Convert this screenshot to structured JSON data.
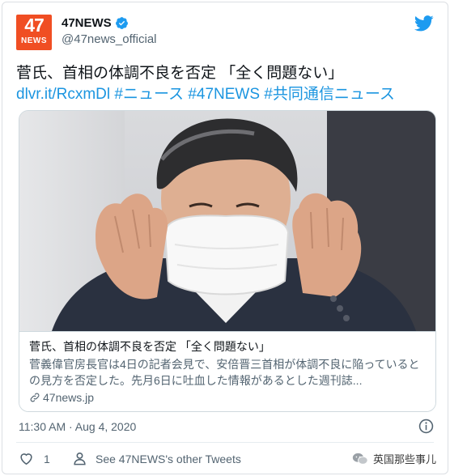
{
  "account": {
    "logo_number": "47",
    "logo_text": "NEWS",
    "display_name": "47NEWS",
    "handle": "@47news_official",
    "verified": true
  },
  "tweet": {
    "text_line1": "菅氏、首相の体調不良を否定 「全く問題ない」",
    "link": "dlvr.it/RcxmDl",
    "hashtag1": "#ニュース",
    "hashtag2": "#47NEWS",
    "hashtag3": "#共同通信ニュース"
  },
  "card": {
    "title": "菅氏、首相の体調不良を否定 「全く問題ない」",
    "description": "菅義偉官房長官は4日の記者会見で、安倍晋三首相が体調不良に陥っているとの見方を否定した。先月6日に吐血した情報があるとした週刊誌...",
    "domain": "47news.jp"
  },
  "meta": {
    "timestamp": "11:30 AM · Aug 4, 2020"
  },
  "actions": {
    "like_count": "1",
    "other_tweets": "See 47NEWS's other Tweets"
  },
  "watermark": {
    "text": "英国那些事儿"
  },
  "colors": {
    "link": "#1b95e0",
    "logo": "#f04e23",
    "twitter_blue": "#1d9bf0"
  }
}
